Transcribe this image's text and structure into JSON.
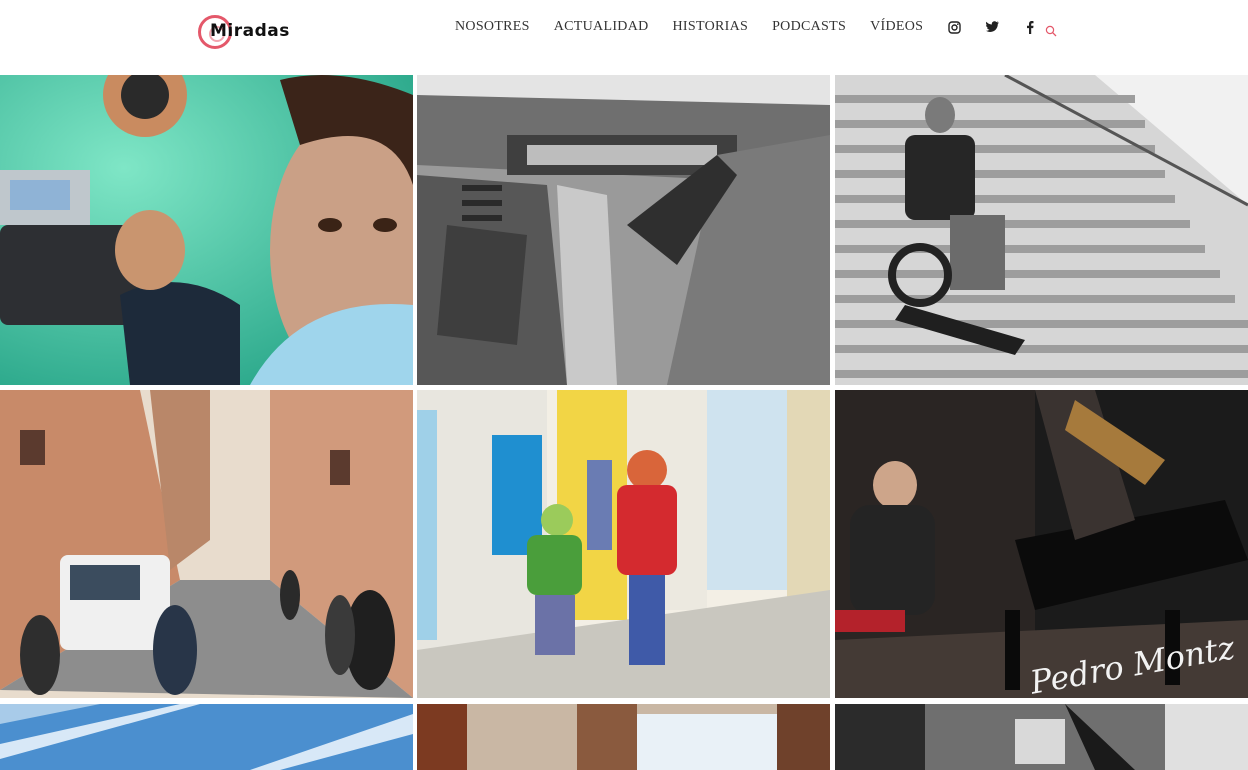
{
  "brand": {
    "logo_text": "Miradas"
  },
  "nav": {
    "items": [
      {
        "label": "NOSOTRES"
      },
      {
        "label": "ACTUALIDAD"
      },
      {
        "label": "HISTORIAS"
      },
      {
        "label": "PODCASTS"
      },
      {
        "label": "VÍDEOS"
      }
    ],
    "social": [
      "instagram-icon",
      "twitter-icon",
      "facebook-icon"
    ],
    "search": "search-icon"
  },
  "colors": {
    "accent": "#e4586a",
    "text": "#333333",
    "background": "#ffffff"
  },
  "gallery": {
    "tiles": [
      {
        "name": "boy-with-projector"
      },
      {
        "name": "trench-war-photo"
      },
      {
        "name": "wheelchair-on-stairs"
      },
      {
        "name": "narrow-street"
      },
      {
        "name": "illustrated-children-running"
      },
      {
        "name": "pianist",
        "watermark": "Pedro Montz"
      },
      {
        "name": "sky-contrails"
      },
      {
        "name": "window-curtains"
      },
      {
        "name": "bw-interior"
      }
    ]
  }
}
